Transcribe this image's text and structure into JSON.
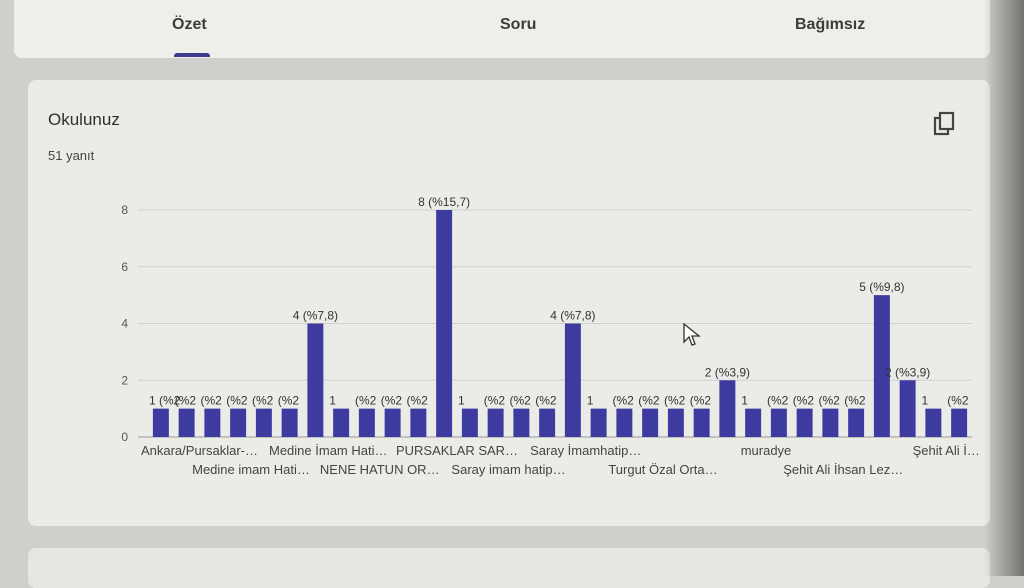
{
  "tabs": [
    {
      "label": "Özet",
      "active": true
    },
    {
      "label": "Soru",
      "active": false
    },
    {
      "label": "Bağımsız",
      "active": false
    }
  ],
  "question": {
    "title": "Okulunuz",
    "response_count": "51 yanıt",
    "copy_icon": "copy-icon"
  },
  "colors": {
    "bar": "#3d3ba0",
    "accent": "#3c3a8e"
  },
  "chart_data": {
    "type": "bar",
    "ylim": [
      0,
      8
    ],
    "yticks": [
      0,
      2,
      4,
      6,
      8
    ],
    "values": [
      1,
      1,
      1,
      1,
      1,
      1,
      4,
      1,
      1,
      1,
      1,
      8,
      1,
      1,
      1,
      1,
      4,
      1,
      1,
      1,
      1,
      1,
      2,
      1,
      1,
      1,
      1,
      1,
      5,
      2,
      1,
      1
    ],
    "value_labels": [
      "1 (%2",
      "(%2",
      "(%2",
      "(%2",
      "(%2",
      "(%2",
      "4 (%7,8)",
      "1",
      "(%2",
      "(%2",
      "(%2",
      "8 (%15,7)",
      "1",
      "(%2",
      "(%2",
      "(%2",
      "4 (%7,8)",
      "1",
      "(%2",
      "(%2",
      "(%2",
      "(%2",
      "2 (%3,9)",
      "1",
      "(%2",
      "(%2",
      "(%2",
      "(%2",
      "5 (%9,8)",
      "2 (%3,9)",
      "1",
      "(%2"
    ],
    "category_labels_row1": [
      "Ankara/Pursaklar-…",
      "Medine İmam Hati…",
      "PURSAKLAR SAR…",
      "Saray İmamhatip…",
      "muradye",
      "Şehit Ali İ…"
    ],
    "category_labels_row2": [
      "Medine imam Hati…",
      "NENE HATUN OR…",
      "Saray imam hatip…",
      "Turgut Özal Orta…",
      "Şehit Ali İhsan Lez…"
    ]
  }
}
